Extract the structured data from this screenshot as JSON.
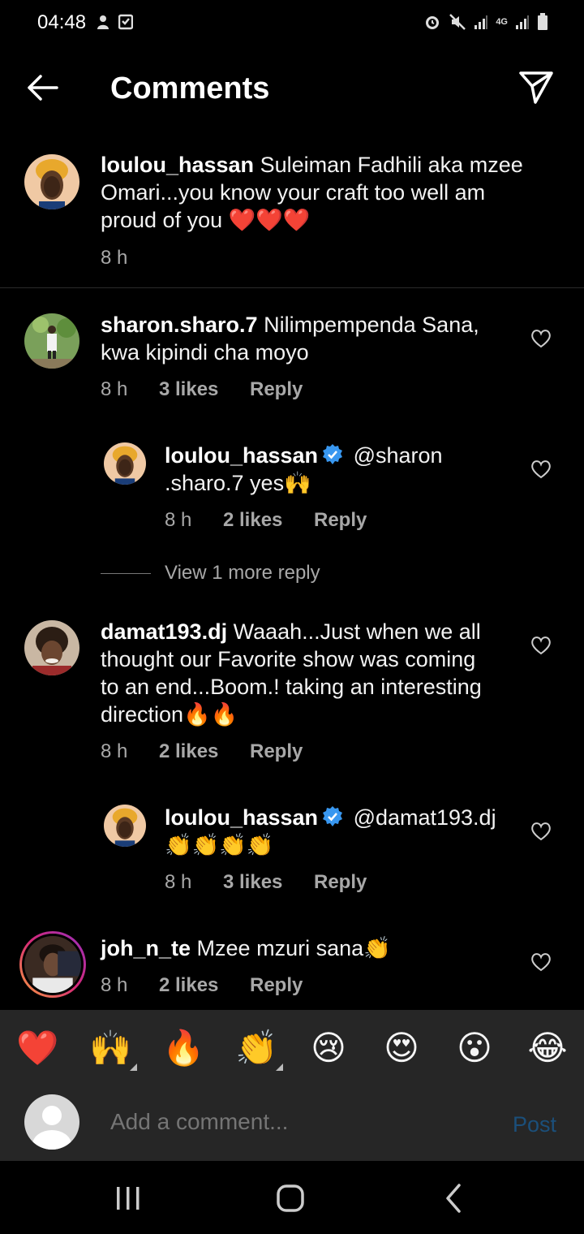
{
  "status": {
    "time": "04:48",
    "network": "4G"
  },
  "header": {
    "title": "Comments"
  },
  "comments": [
    {
      "username": "loulou_hassan",
      "text": "Suleiman Fadhili aka mzee",
      "text2": "Omari...you know your craft too well am",
      "text3": "proud of you ❤️❤️❤️",
      "time": "8 h"
    },
    {
      "username": "sharon.sharo.7",
      "text": "Nilimpempenda Sana,",
      "text2": "kwa kipindi cha moyo",
      "time": "8 h",
      "likes": "3 likes",
      "reply": "Reply"
    },
    {
      "username": "loulou_hassan",
      "text": "@sharon",
      "text2": ".sharo.7 yes🙌",
      "time": "8 h",
      "likes": "2 likes",
      "reply": "Reply"
    },
    {
      "username": "damat193.dj",
      "text": "Waaah...Just when we all",
      "text2": "thought our Favorite show was coming",
      "text3": "to an end...Boom.! taking an interesting",
      "text4": "direction🔥🔥",
      "time": "8 h",
      "likes": "2 likes",
      "reply": "Reply"
    },
    {
      "username": "loulou_hassan",
      "text": "@damat193.dj",
      "text2": "👏👏👏👏",
      "time": "8 h",
      "likes": "3 likes",
      "reply": "Reply"
    },
    {
      "username": "joh_n_te",
      "text": "Mzee mzuri sana👏",
      "time": "8 h",
      "likes": "2 likes",
      "reply": "Reply"
    }
  ],
  "view_more": "View 1 more reply",
  "reactions": [
    "❤️",
    "🙌",
    "🔥",
    "👏",
    "😢",
    "😍",
    "😮",
    "😂"
  ],
  "input": {
    "placeholder": "Add a comment...",
    "post": "Post"
  }
}
